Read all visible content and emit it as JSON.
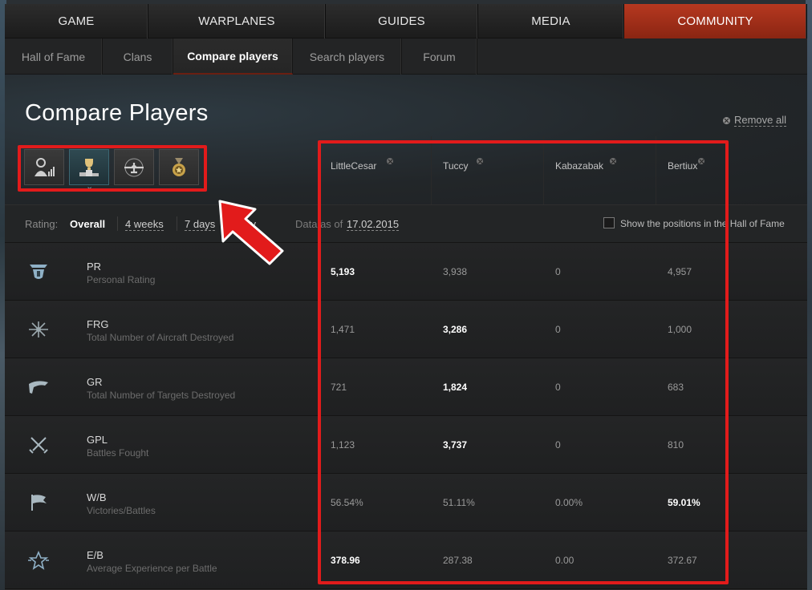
{
  "main_nav": [
    "GAME",
    "WARPLANES",
    "GUIDES",
    "MEDIA",
    "COMMUNITY"
  ],
  "sub_nav": [
    "Hall of Fame",
    "Clans",
    "Compare players",
    "Search players",
    "Forum"
  ],
  "page_title": "Compare Players",
  "remove_all": "Remove all",
  "tab_icons": [
    "pilot-rating-icon",
    "trophy-podium-icon",
    "aircraft-icon",
    "medal-icon"
  ],
  "players": [
    "LittleCesar",
    "Tuccy",
    "Kabazabak",
    "Bertiux"
  ],
  "rating": {
    "label": "Rating:",
    "overall": "Overall",
    "four_weeks": "4 weeks",
    "seven_days": "7 days",
    "day": "day",
    "data_label": "Data as of",
    "data_date": "17.02.2015",
    "hall_of_fame_check": "Show the positions in the Hall of Fame"
  },
  "rows": [
    {
      "code": "PR",
      "desc": "Personal Rating",
      "values": [
        "5,193",
        "3,938",
        "0",
        "4,957"
      ],
      "best": 0
    },
    {
      "code": "FRG",
      "desc": "Total Number of Aircraft Destroyed",
      "values": [
        "1,471",
        "3,286",
        "0",
        "1,000"
      ],
      "best": 1
    },
    {
      "code": "GR",
      "desc": "Total Number of Targets Destroyed",
      "values": [
        "721",
        "1,824",
        "0",
        "683"
      ],
      "best": 1
    },
    {
      "code": "GPL",
      "desc": "Battles Fought",
      "values": [
        "1,123",
        "3,737",
        "0",
        "810"
      ],
      "best": 1
    },
    {
      "code": "W/B",
      "desc": "Victories/Battles",
      "values": [
        "56.54%",
        "51.11%",
        "0.00%",
        "59.01%"
      ],
      "best": 3
    },
    {
      "code": "E/B",
      "desc": "Average Experience per Battle",
      "values": [
        "378.96",
        "287.38",
        "0.00",
        "372.67"
      ],
      "best": 0
    }
  ],
  "colors": {
    "accent": "#b63820",
    "highlight_box": "#e21b1b",
    "active_tab": "#2f4a52"
  }
}
